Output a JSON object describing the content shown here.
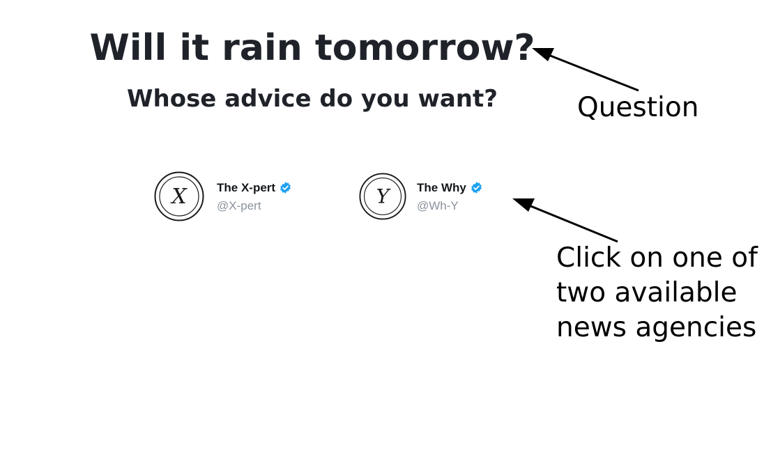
{
  "header": {
    "question": "Will it rain tomorrow?",
    "prompt": "Whose advice do you want?"
  },
  "agencies": [
    {
      "name": "The X-pert",
      "handle": "@X-pert",
      "avatar_letter": "X",
      "avatar_icon": "x-monogram-seal",
      "verified": true
    },
    {
      "name": "The Why",
      "handle": "@Wh-Y",
      "avatar_letter": "Y",
      "avatar_icon": "y-monogram-seal",
      "verified": true
    }
  ],
  "annotations": {
    "question_label": "Question",
    "agencies_label_lines": [
      "Click on one of",
      "two available",
      "news agencies"
    ]
  },
  "colors": {
    "text": "#1f2329",
    "handle": "#8a939c",
    "verified_badge": "#1da1f2",
    "annotation": "#000000"
  }
}
